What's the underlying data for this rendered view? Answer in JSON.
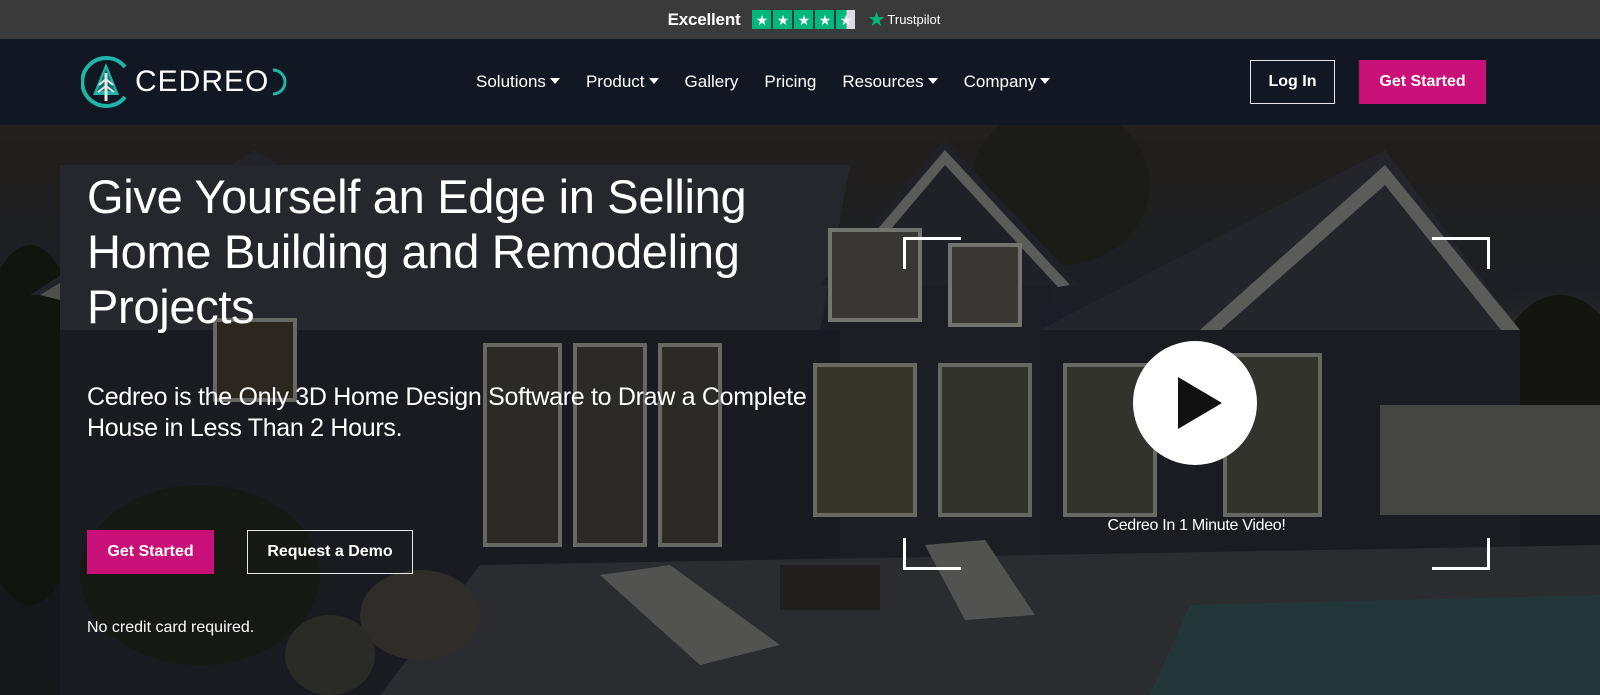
{
  "trustpilot": {
    "rating_label": "Excellent",
    "stars": 4.5,
    "star_glyph": "★",
    "brand": "Trustpilot",
    "brand_color": "#00b67a"
  },
  "nav": {
    "logo_text": "CEDREO",
    "logo_accent": "#1fb5a8",
    "menu": [
      {
        "label": "Solutions",
        "dropdown": true
      },
      {
        "label": "Product",
        "dropdown": true
      },
      {
        "label": "Gallery",
        "dropdown": false
      },
      {
        "label": "Pricing",
        "dropdown": false
      },
      {
        "label": "Resources",
        "dropdown": true
      },
      {
        "label": "Company",
        "dropdown": true
      }
    ],
    "login_label": "Log In",
    "get_started_label": "Get Started",
    "accent_color": "#c90f78"
  },
  "hero": {
    "headline": "Give Yourself an Edge in Selling Home Building and Remodeling Projects",
    "subheadline": "Cedreo is the Only 3D Home Design Software to Draw a Complete House in Less Than 2 Hours.",
    "get_started_label": "Get Started",
    "demo_label": "Request a Demo",
    "note": "No credit card required.",
    "video_caption": "Cedreo In 1 Minute Video!",
    "background_image": "dark-house-exterior-render-at-dusk"
  }
}
